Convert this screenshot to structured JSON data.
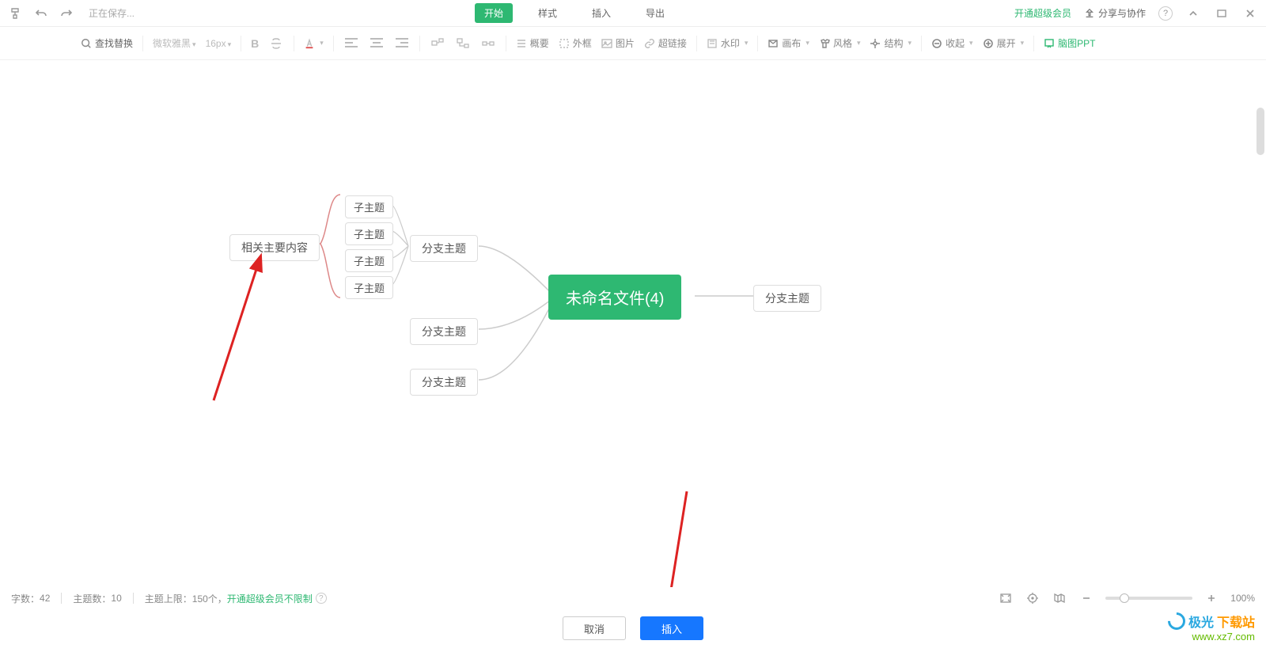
{
  "header": {
    "saving": "正在保存...",
    "tabs": {
      "start": "开始",
      "style": "样式",
      "insert": "插入",
      "export": "导出"
    },
    "vip": "开通超级会员",
    "share": "分享与协作"
  },
  "toolbar": {
    "search": "查找替换",
    "font": "微软雅黑",
    "fontsize": "16px",
    "outline": "概要",
    "frame": "外框",
    "image": "图片",
    "hyperlink": "超链接",
    "watermark": "水印",
    "canvas": "画布",
    "style": "风格",
    "structure": "结构",
    "collapse": "收起",
    "expand": "展开",
    "mindppt": "脑图PPT"
  },
  "mindmap": {
    "center": "未命名文件(4)",
    "branch_left1": "分支主题",
    "branch_left2": "分支主题",
    "branch_left3": "分支主题",
    "branch_right": "分支主题",
    "related": "相关主要内容",
    "child1": "子主题",
    "child2": "子主题",
    "child3": "子主题",
    "child4": "子主题"
  },
  "status": {
    "wordcount_label": "字数：",
    "wordcount": "42",
    "topiccount_label": "主题数：",
    "topiccount": "10",
    "topiclimit_label": "主题上限：",
    "topiclimit": "150个，",
    "limit_link": "开通超级会员不限制",
    "zoom": "100%"
  },
  "buttons": {
    "cancel": "取消",
    "insert": "插入"
  },
  "watermark": {
    "brand1": "极光",
    "brand2": "下载站",
    "url": "www.xz7.com"
  }
}
